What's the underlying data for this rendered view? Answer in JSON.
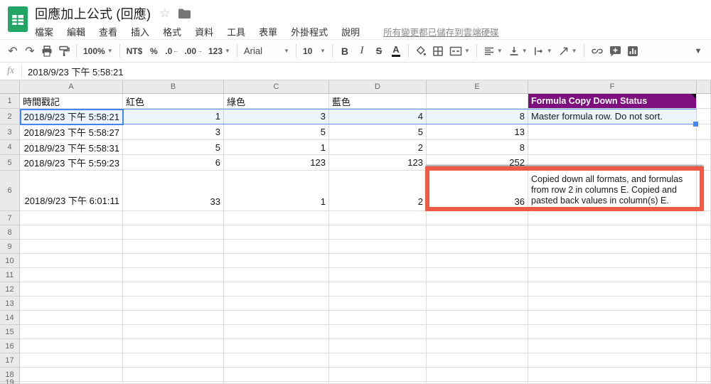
{
  "colors": {
    "logo_green": "#23a566",
    "selection_blue": "#4285f4",
    "header_purple": "#7e0d7e",
    "annotation_red": "#ee5a44"
  },
  "header": {
    "title": "回應加上公式 (回應)",
    "star_icon": "star",
    "folder_icon": "folder",
    "menus": [
      "檔案",
      "編輯",
      "查看",
      "插入",
      "格式",
      "資料",
      "工具",
      "表單",
      "外掛程式",
      "說明"
    ],
    "save_status": "所有變更都已儲存到雲端硬碟"
  },
  "toolbar": {
    "undo": "↶",
    "redo": "↷",
    "zoom": "100%",
    "currency": "NT$",
    "percent": "%",
    "decrease_decimal": ".0",
    "increase_decimal": ".00",
    "number_format": "123",
    "font_family": "Arial",
    "font_size": "10",
    "bold": "B",
    "italic": "I",
    "strikethrough": "S",
    "text_color": "A",
    "more": "▼",
    "caret": "▾"
  },
  "formula_bar": {
    "label": "fx",
    "value": "2018/9/23 下午 5:58:21"
  },
  "sheet": {
    "column_headers": [
      "A",
      "B",
      "C",
      "D",
      "E",
      "F"
    ],
    "row_numbers": [
      "1",
      "2",
      "3",
      "4",
      "5",
      "6",
      "7",
      "8",
      "9",
      "10",
      "11",
      "12",
      "13",
      "14",
      "15",
      "16",
      "17",
      "18",
      "19"
    ],
    "rows": {
      "r1": {
        "a": "時間戳記",
        "b": "紅色",
        "c": "綠色",
        "d": "藍色",
        "e": "",
        "f": "Formula Copy Down Status"
      },
      "r2": {
        "a": "2018/9/23 下午 5:58:21",
        "b": "1",
        "c": "3",
        "d": "4",
        "e": "8",
        "f": "Master formula row. Do not sort."
      },
      "r3": {
        "a": "2018/9/23 下午 5:58:27",
        "b": "3",
        "c": "5",
        "d": "5",
        "e": "13",
        "f": ""
      },
      "r4": {
        "a": "2018/9/23 下午 5:58:31",
        "b": "5",
        "c": "1",
        "d": "2",
        "e": "8",
        "f": ""
      },
      "r5": {
        "a": "2018/9/23 下午 5:59:23",
        "b": "6",
        "c": "123",
        "d": "123",
        "e": "252",
        "f": ""
      },
      "r6": {
        "a": "2018/9/23 下午 6:01:11",
        "b": "33",
        "c": "1",
        "d": "2",
        "e": "36",
        "f": "Copied down all formats, and formulas from row 2 in columns E. Copied and pasted back values in column(s) E."
      }
    }
  }
}
